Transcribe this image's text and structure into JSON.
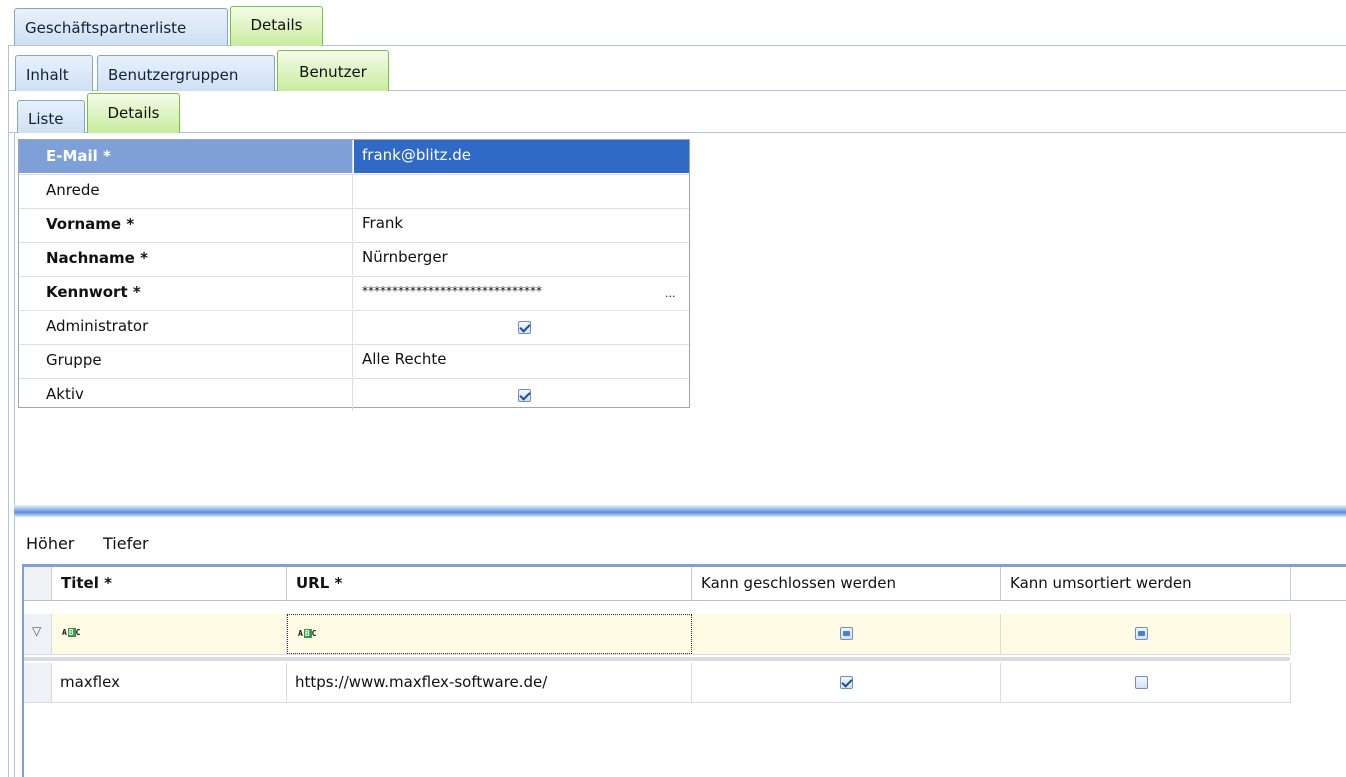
{
  "top_tabs": [
    {
      "label": "Geschäftspartnerliste",
      "active": false
    },
    {
      "label": "Details",
      "active": true
    }
  ],
  "second_tabs": [
    {
      "label": "Inhalt",
      "active": false
    },
    {
      "label": "Benutzergruppen",
      "active": false
    },
    {
      "label": "Benutzer",
      "active": true
    }
  ],
  "third_tabs": [
    {
      "label": "Liste",
      "active": false
    },
    {
      "label": "Details",
      "active": true
    }
  ],
  "details": {
    "rows": [
      {
        "label": "E-Mail *",
        "value": "frank@blitz.de"
      },
      {
        "label": "Anrede",
        "value": ""
      },
      {
        "label": "Vorname *",
        "value": "Frank"
      },
      {
        "label": "Nachname *",
        "value": "Nürnberger"
      },
      {
        "label": "Kennwort *",
        "value": "******************************",
        "ellipsis": "..."
      },
      {
        "label": "Administrator",
        "checked": true
      },
      {
        "label": "Gruppe",
        "value": "Alle Rechte"
      },
      {
        "label": "Aktiv",
        "checked": true
      }
    ]
  },
  "toolbar": {
    "up_label": "Höher",
    "down_label": "Tiefer"
  },
  "table": {
    "columns": [
      "Titel *",
      "URL *",
      "Kann geschlossen werden",
      "Kann umsortiert werden"
    ],
    "filter_icon": "filter-funnel-icon",
    "filter_text_icon": "abc-text-filter-icon",
    "rows": [
      {
        "title": "maxflex",
        "url": "https://www.maxflex-software.de/",
        "closable": true,
        "sortable": false
      }
    ]
  },
  "colors": {
    "active_tab": "#c8ec9e",
    "selection": "#3169c6",
    "header_highlight": "#7f9fd9",
    "filter_row": "#fffbe5"
  }
}
